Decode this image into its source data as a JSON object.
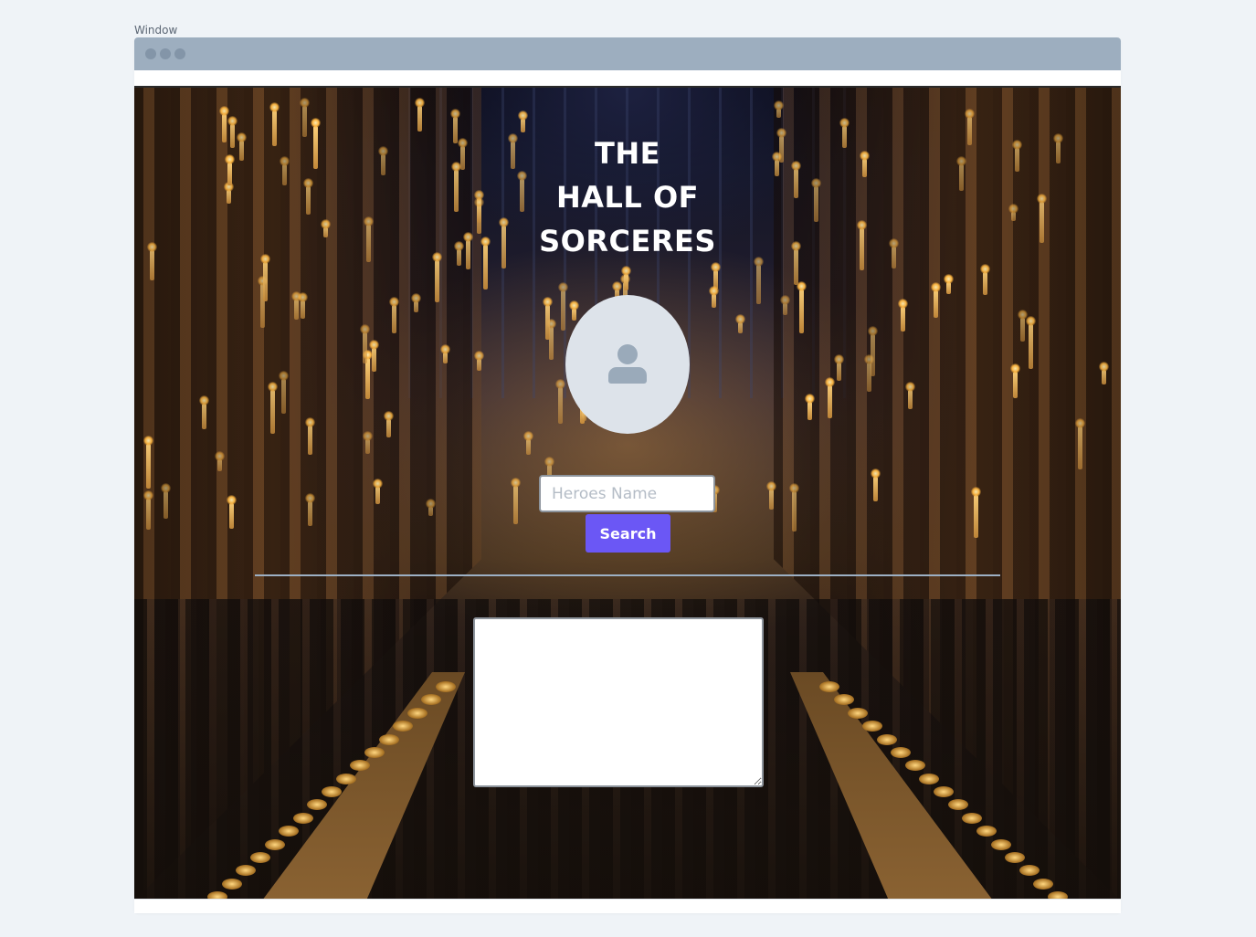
{
  "window": {
    "label": "Window"
  },
  "page": {
    "title_lines": [
      "THE",
      "HALL OF",
      "SORCERES"
    ]
  },
  "avatar": {
    "icon": "user-placeholder-icon"
  },
  "search": {
    "placeholder": "Heroes Name",
    "value": "",
    "button_label": "Search"
  },
  "results": {
    "value": ""
  },
  "colors": {
    "accent": "#6b57f5",
    "titlebar": "#9daebf",
    "avatar_bg": "#dde3ea",
    "divider": "#9db0c4"
  }
}
